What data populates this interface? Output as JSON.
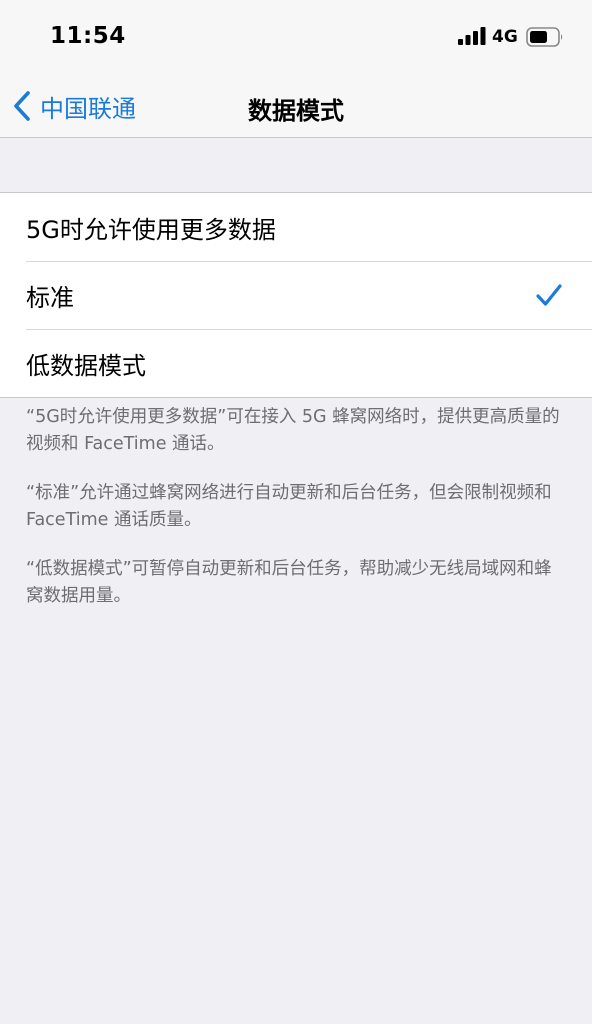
{
  "status_bar": {
    "time": "11:54",
    "network": "4G",
    "icons": [
      "signal-icon",
      "battery-icon"
    ]
  },
  "nav": {
    "back_label": "中国联通",
    "title": "数据模式",
    "back_icon": "chevron-left-icon",
    "accent_color": "#1a7bd8"
  },
  "options": [
    {
      "label": "5G时允许使用更多数据",
      "selected": false
    },
    {
      "label": "标准",
      "selected": true
    },
    {
      "label": "低数据模式",
      "selected": false
    }
  ],
  "footer": {
    "paragraphs": [
      "“5G时允许使用更多数据”可在接入 5G 蜂窝网络时，提供更高质量的视频和 FaceTime 通话。",
      "“标准”允许通过蜂窝网络进行自动更新和后台任务，但会限制视频和 FaceTime 通话质量。",
      "“低数据模式”可暂停自动更新和后台任务，帮助减少无线局域网和蜂窝数据用量。"
    ]
  }
}
